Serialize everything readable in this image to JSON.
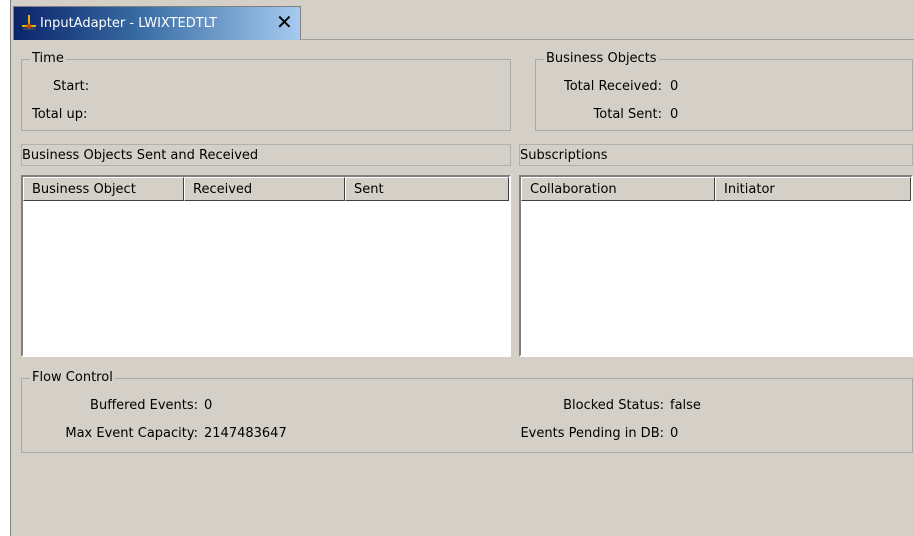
{
  "tab": {
    "title": "InputAdapter - LWIXTEDTLT",
    "close": "✕",
    "icon": "connector-icon"
  },
  "time": {
    "legend": "Time",
    "start_label": "Start:",
    "total_up_label": "Total up:"
  },
  "business_objects": {
    "legend": "Business Objects",
    "total_received_label": "Total Received:",
    "total_received": "0",
    "total_sent_label": "Total Sent:",
    "total_sent": "0"
  },
  "bo_sent_received": {
    "title": "Business Objects Sent and Received",
    "columns": [
      "Business Object",
      "Received",
      "Sent"
    ]
  },
  "subscriptions": {
    "title": "Subscriptions",
    "columns": [
      "Collaboration",
      "Initiator"
    ]
  },
  "flow_control": {
    "legend": "Flow Control",
    "buffered_events_label": "Buffered Events:",
    "buffered_events": "0",
    "max_event_capacity_label": "Max Event Capacity:",
    "max_event_capacity": "2147483647",
    "blocked_status_label": "Blocked Status:",
    "blocked_status": "false",
    "events_pending_label": "Events Pending in DB:",
    "events_pending": "0"
  }
}
